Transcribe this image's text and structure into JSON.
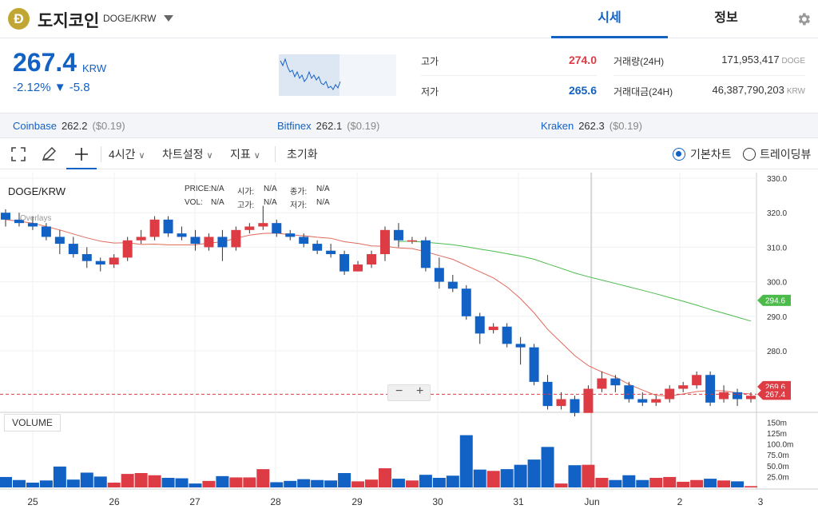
{
  "header": {
    "logo_glyph": "Ð",
    "coin_name": "도지코인",
    "pair": "DOGE/KRW",
    "tabs": [
      {
        "label": "시세",
        "active": true
      },
      {
        "label": "정보",
        "active": false
      }
    ]
  },
  "summary": {
    "price": "267.4",
    "unit": "KRW",
    "change": "-2.12% ▼ -5.8",
    "high_label": "고가",
    "high": "274.0",
    "low_label": "저가",
    "low": "265.6",
    "volume_label": "거래량(24H)",
    "volume": "171,953,417",
    "volume_unit": "DOGE",
    "amount_label": "거래대금(24H)",
    "amount": "46,387,790,203",
    "amount_unit": "KRW"
  },
  "exchanges": [
    {
      "name": "Coinbase",
      "price": "262.2",
      "usd": "($0.19)"
    },
    {
      "name": "Bitfinex",
      "price": "262.1",
      "usd": "($0.19)"
    },
    {
      "name": "Kraken",
      "price": "262.3",
      "usd": "($0.19)"
    }
  ],
  "toolbar": {
    "interval": "4시간",
    "settings": "차트설정",
    "indicator": "지표",
    "reset": "초기화",
    "basic_chart": "기본차트",
    "tradingview": "트레이딩뷰"
  },
  "legend": {
    "pair": "DOGE/KRW",
    "overlays": "Overlays",
    "price_label": "PRICE:",
    "price": "N/A",
    "open_label": "시가:",
    "open": "N/A",
    "close_label": "종가:",
    "close": "N/A",
    "vol_label": "VOL:",
    "vol": "N/A",
    "high_label": "고가:",
    "high": "N/A",
    "low_label": "저가:",
    "low": "N/A",
    "volume_panel": "VOLUME"
  },
  "colors": {
    "up": "#dd3c44",
    "down": "#1261c4",
    "ma_short": "#e0695b",
    "ma_long": "#4cbb4c"
  },
  "chart_data": {
    "type": "candlestick",
    "y_ticks": [
      "330.0",
      "320.0",
      "310.0",
      "300.0",
      "290.0",
      "280.0"
    ],
    "price_ylim": [
      262,
      332
    ],
    "volume_ticks": [
      "150m",
      "125m",
      "100.0m",
      "75.0m",
      "50.0m",
      "25.0m"
    ],
    "volume_ylim": [
      0,
      170
    ],
    "x_ticks": [
      "25",
      "26",
      "27",
      "28",
      "29",
      "30",
      "31",
      "Jun",
      "2",
      "3"
    ],
    "current_price": 267.4,
    "ma_long_last": 294.6,
    "ma_short_last": 269.6,
    "candles": [
      [
        320,
        318,
        321,
        316
      ],
      [
        318,
        317,
        320,
        316
      ],
      [
        317,
        316,
        319,
        315
      ],
      [
        316,
        313,
        317,
        312
      ],
      [
        313,
        311,
        315,
        308
      ],
      [
        311,
        308,
        313,
        307
      ],
      [
        308,
        306,
        310,
        304
      ],
      [
        306,
        305,
        307,
        303
      ],
      [
        305,
        307,
        308,
        304
      ],
      [
        307,
        312,
        313,
        306
      ],
      [
        312,
        313,
        315,
        311
      ],
      [
        313,
        318,
        319,
        312
      ],
      [
        318,
        314,
        319,
        313
      ],
      [
        314,
        313,
        316,
        312
      ],
      [
        313,
        311,
        315,
        309
      ],
      [
        310,
        313,
        314,
        309
      ],
      [
        313,
        310,
        315,
        306
      ],
      [
        310,
        315,
        316,
        309
      ],
      [
        315,
        316,
        317,
        314
      ],
      [
        316,
        317,
        322,
        315
      ],
      [
        317,
        314,
        318,
        313
      ],
      [
        314,
        313,
        315,
        312
      ],
      [
        313,
        311,
        314,
        310
      ],
      [
        311,
        309,
        312,
        308
      ],
      [
        309,
        308,
        311,
        307
      ],
      [
        308,
        303,
        309,
        302
      ],
      [
        303,
        305,
        306,
        303
      ],
      [
        305,
        308,
        309,
        304
      ],
      [
        308,
        315,
        316,
        306
      ],
      [
        315,
        312,
        317,
        310
      ],
      [
        312,
        312,
        313,
        311
      ],
      [
        312,
        304,
        313,
        303
      ],
      [
        304,
        300,
        307,
        298
      ],
      [
        300,
        298,
        302,
        297
      ],
      [
        298,
        290,
        299,
        289
      ],
      [
        290,
        285,
        291,
        282
      ],
      [
        286,
        287,
        288,
        285
      ],
      [
        287,
        282,
        288,
        281
      ],
      [
        282,
        281,
        284,
        276
      ],
      [
        281,
        271,
        282,
        270
      ],
      [
        271,
        264,
        273,
        263
      ],
      [
        264,
        266,
        268,
        263
      ],
      [
        266,
        262,
        267,
        261
      ],
      [
        262,
        269,
        270,
        263
      ],
      [
        269,
        272,
        274,
        268
      ],
      [
        272,
        270,
        273,
        268
      ],
      [
        270,
        266,
        271,
        265
      ],
      [
        266,
        265,
        268,
        264
      ],
      [
        265,
        266,
        267,
        264
      ],
      [
        266,
        269,
        270,
        265
      ],
      [
        269,
        270,
        271,
        268
      ],
      [
        270,
        273,
        274,
        269
      ],
      [
        273,
        265,
        274,
        264
      ],
      [
        266,
        268,
        270,
        265
      ],
      [
        268,
        266,
        269,
        264
      ],
      [
        266,
        267,
        268,
        265
      ]
    ],
    "volumes": [
      24,
      17,
      11,
      16,
      48,
      18,
      34,
      25,
      11,
      31,
      33,
      28,
      22,
      21,
      9,
      15,
      26,
      23,
      23,
      42,
      12,
      15,
      19,
      17,
      16,
      33,
      14,
      18,
      44,
      20,
      16,
      29,
      22,
      27,
      120,
      41,
      38,
      42,
      52,
      64,
      93,
      9,
      51,
      52,
      22,
      17,
      28,
      17,
      22,
      24,
      13,
      17,
      20,
      16,
      14,
      3
    ]
  }
}
